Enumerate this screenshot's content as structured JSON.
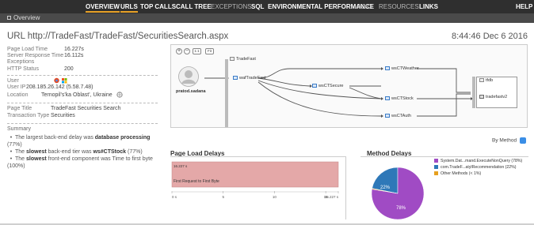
{
  "nav": {
    "items": [
      {
        "label": "OVERVIEW",
        "active": true,
        "dim": false
      },
      {
        "label": "URLS",
        "active": true,
        "dim": false
      },
      {
        "label": "TOP CALLS",
        "active": false,
        "dim": false
      },
      {
        "label": "CALL TREE",
        "active": false,
        "dim": false
      },
      {
        "label": "EXCEPTIONS",
        "active": false,
        "dim": true
      },
      {
        "label": "SQL",
        "active": false,
        "dim": false
      },
      {
        "label": "ENVIRONMENTAL PERFORMANCE",
        "active": false,
        "dim": false
      },
      {
        "label": "AJAX",
        "active": false,
        "dim": true
      },
      {
        "label": "RESOURCES",
        "active": false,
        "dim": true
      },
      {
        "label": "LINKS",
        "active": false,
        "dim": false
      }
    ],
    "help": "HELP"
  },
  "subbar": {
    "label": "Overview"
  },
  "header": {
    "url_title": "URL http://TradeFast/TradeFast/SecuritiesSearch.aspx",
    "timestamp": "8:44:46 Dec 6 2016"
  },
  "info": {
    "page_load_time_label": "Page Load Time",
    "page_load_time_value": "16.227s",
    "server_response_time_label": "Server Response Time",
    "server_response_time_value": "16.112s",
    "exceptions_label": "Exceptions",
    "http_status_label": "HTTP Status",
    "http_status_value": "200",
    "user_label": "User",
    "user_ip_label": "User IP",
    "user_ip_value": "208.185.26.142 (5.58.7.48)",
    "location_label": "Location",
    "location_value": "Ternopil's'ka Oblast', Ukraine",
    "page_title_label": "Page Title",
    "page_title_value": "TradeFast Securities Search",
    "transaction_type_label": "Transaction Type",
    "transaction_type_value": "Securities"
  },
  "summary": {
    "heading": "Summary",
    "b1_pre": "The largest back-end delay was ",
    "b1_bold": "database processing",
    "b1_post": " (77%)",
    "b2_pre": "The ",
    "b2_bold1": "slowest",
    "b2_mid": " back-end tier was ",
    "b2_bold2": "ws#CTStock",
    "b2_post": " (77%)",
    "b3_pre": "The ",
    "b3_bold": "slowest",
    "b3_post": " front-end component was Time to first byte (100%)"
  },
  "flowmap": {
    "zoom_in": "+",
    "zoom_out": "−",
    "fit_label": "1:1",
    "reset_label": "Fit",
    "tier_name": "TradeFast",
    "user_name": "pratod.sadana",
    "nodes": {
      "wafTradeFast": "wafTradeFast",
      "wsCTSecure": "wsCTSecure",
      "wsCTWeather": "wsCTWeather",
      "wsCTStock": "wsCTStock",
      "wsCTAuth": "wsCTAuth",
      "tfdb": "tfdb",
      "tradefastv2": "tradefastv2"
    }
  },
  "by_method": "By Method",
  "page_load": {
    "title": "Page Load Delays",
    "bar_value_label": "16.227 s",
    "bar_label": "First Request to First Byte",
    "bar_color": "#e4a8a8"
  },
  "method_delays": {
    "title": "Method Delays",
    "legend": [
      {
        "label": "System.Dat...mand.ExecuteNonQuery (78%)",
        "color": "#a04bc4"
      },
      {
        "label": "com.TradeF...atylRecommendation (22%)",
        "color": "#2e78b8"
      },
      {
        "label": "Other Methods (< 1%)",
        "color": "#e6a020"
      }
    ],
    "pct_large": "78%",
    "pct_small": "22%"
  },
  "chart_data": [
    {
      "type": "bar",
      "title": "Page Load Delays",
      "categories": [
        "First Request to First Byte"
      ],
      "values": [
        16.227
      ],
      "xlim": [
        0,
        16.227
      ],
      "x_ticks": [
        "0 s",
        "5",
        "10",
        "15",
        "16.227 s"
      ],
      "orientation": "horizontal"
    },
    {
      "type": "pie",
      "title": "Method Delays",
      "labels": [
        "System.Dat...mand.ExecuteNonQuery",
        "com.TradeF...atylRecommendation",
        "Other Methods"
      ],
      "values": [
        78,
        22,
        0.5
      ],
      "colors": [
        "#a04bc4",
        "#2e78b8",
        "#e6a020"
      ]
    }
  ]
}
